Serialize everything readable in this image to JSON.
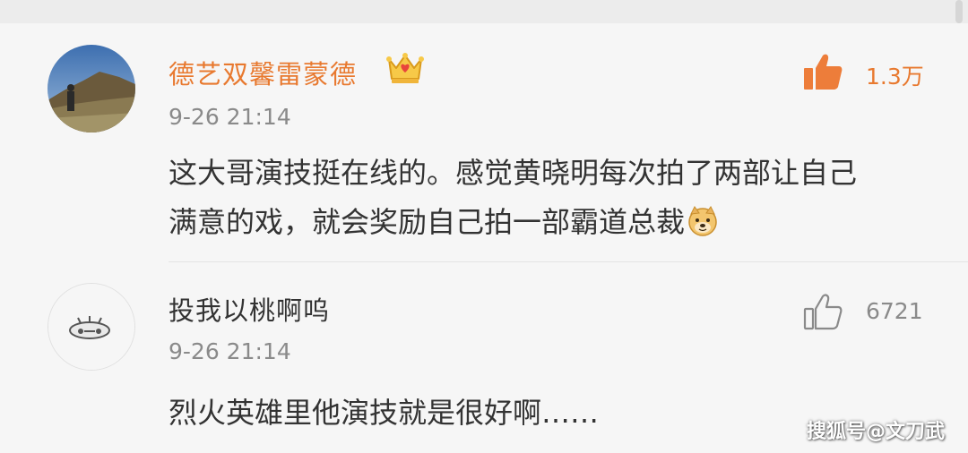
{
  "comments": [
    {
      "username": "德艺双馨雷蒙德",
      "badge_icon": "crown-icon",
      "time": "9-26 21:14",
      "like_count": "1.3万",
      "like_icon": "thumbs-up-icon",
      "content_line1": "这大哥演技挺在线的。感觉黄晓明每次拍了两部让自己",
      "content_line2": "满意的戏，就会奖励自己拍一部霸道总裁",
      "emoji_icon": "doge-emoji-icon"
    },
    {
      "username": "投我以桃啊呜",
      "time": "9-26 21:14",
      "like_count": "6721",
      "like_icon": "thumbs-up-icon",
      "content_line1": "烈火英雄里他演技就是很好啊……"
    }
  ],
  "watermark": "搜狐号@文刀武",
  "colors": {
    "vip_name": "#e8792f",
    "normal_text": "#333333",
    "meta_text": "#8a8a8a",
    "background": "#f6f6f6"
  }
}
